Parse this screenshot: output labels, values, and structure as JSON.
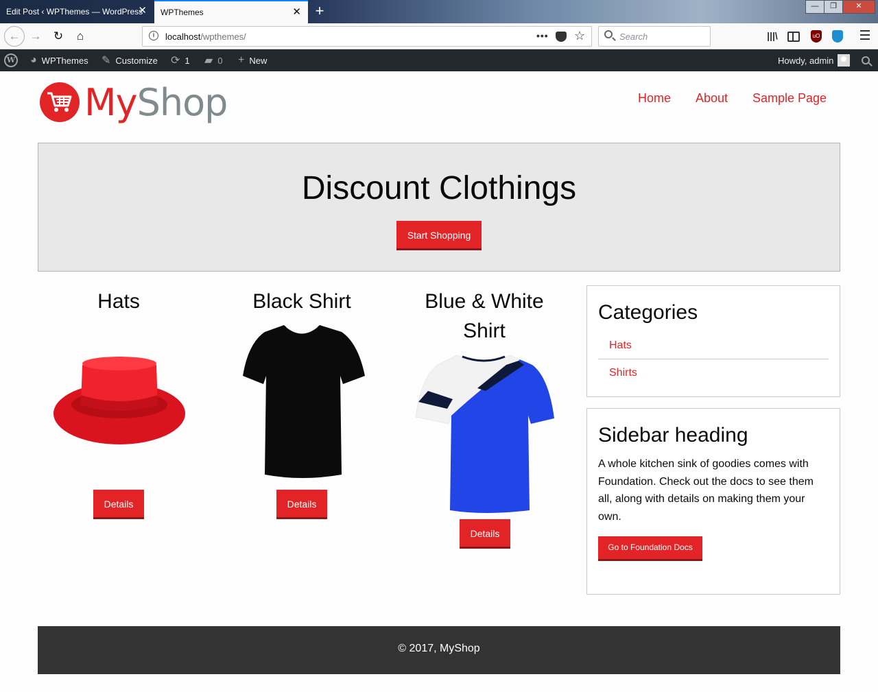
{
  "browser": {
    "tabs": [
      {
        "title": "Edit Post ‹ WPThemes — WordPress",
        "active": false
      },
      {
        "title": "WPThemes",
        "active": true
      }
    ],
    "url_host": "localhost",
    "url_path": "/wpthemes/",
    "url_dots": "•••",
    "search_placeholder": "Search",
    "ublock_label": "uO",
    "window_controls": {
      "minimize": "—",
      "maximize": "❐",
      "close": "✕"
    },
    "tab_close": "✕",
    "new_tab": "+"
  },
  "admin_bar": {
    "site_name": "WPThemes",
    "customize": "Customize",
    "updates_count": "1",
    "comments_count": "0",
    "new": "New",
    "howdy": "Howdy, admin"
  },
  "site": {
    "logo_my": "My",
    "logo_shop": "Shop",
    "nav": [
      "Home",
      "About",
      "Sample Page"
    ],
    "brand_color": "#e32427"
  },
  "hero": {
    "title": "Discount Clothings",
    "button": "Start Shopping"
  },
  "products": [
    {
      "title": "Hats",
      "button": "Details"
    },
    {
      "title": "Black Shirt",
      "button": "Details"
    },
    {
      "title": "Blue & White Shirt",
      "button": "Details"
    }
  ],
  "sidebar": {
    "categories_title": "Categories",
    "categories": [
      "Hats",
      "Shirts"
    ],
    "heading": "Sidebar heading",
    "text": "A whole kitchen sink of goodies comes with Foundation. Check out the docs to see them all, along with details on making them your own.",
    "button": "Go to Foundation Docs"
  },
  "footer": {
    "text": "© 2017, MyShop"
  }
}
